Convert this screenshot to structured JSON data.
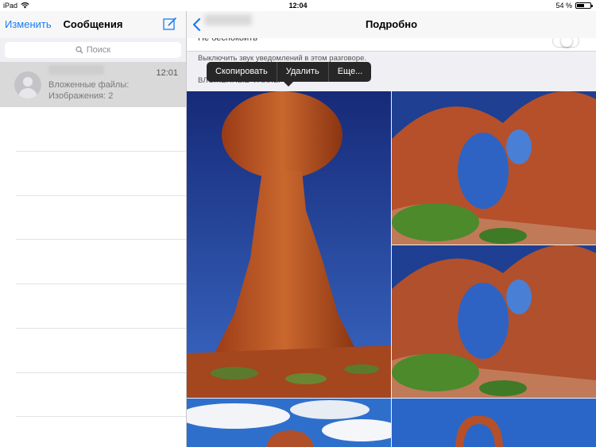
{
  "status_bar": {
    "device": "iPad",
    "time": "12:04",
    "battery_text": "54 %",
    "battery_level": 0.54
  },
  "messages_pane": {
    "edit_label": "Изменить",
    "title": "Сообщения",
    "compose_icon": "compose-icon",
    "search_placeholder": "Поиск",
    "conversation": {
      "time": "12:01",
      "line1": "Вложенные файлы:",
      "line2": "Изображения: 2"
    }
  },
  "details_pane": {
    "back_icon": "chevron-left-icon",
    "title": "Подробно",
    "partial_row_label": "Не беспокоить",
    "mute_footnote": "Выключить звук уведомлений в этом разговоре.",
    "attachments_header": "ВЛОЖЕННЫЕ ФАЙЛЫ",
    "context_menu": [
      "Скопировать",
      "Удалить",
      "Еще..."
    ]
  },
  "colors": {
    "accent": "#1a7cf4",
    "menu_bg": "#272727",
    "selected_row": "#d9d9d9"
  }
}
